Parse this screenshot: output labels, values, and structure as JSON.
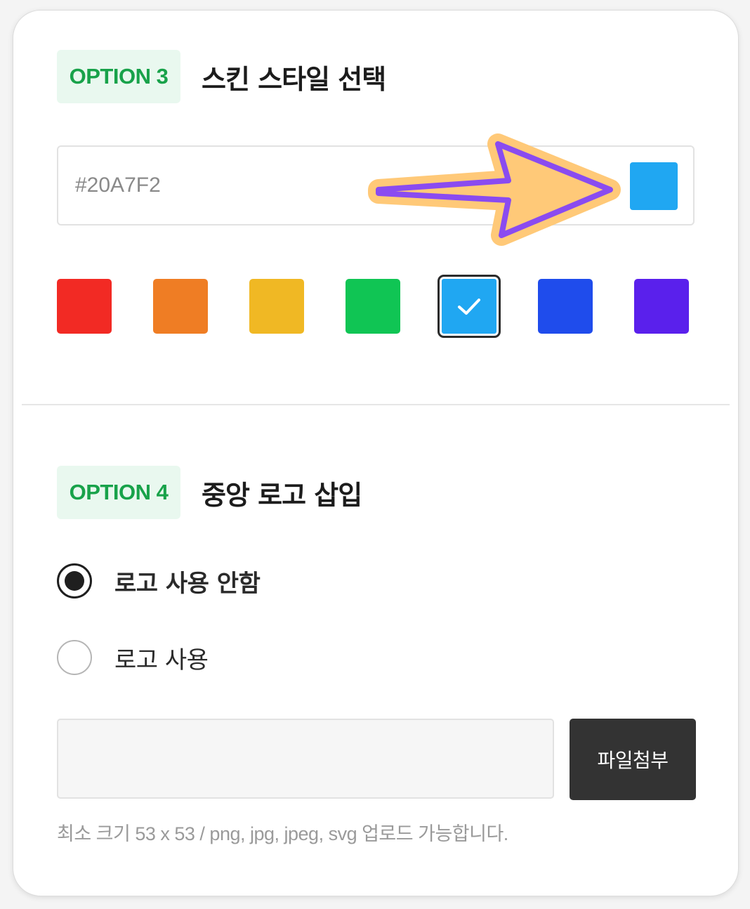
{
  "option3": {
    "badge": "OPTION 3",
    "title": "스킨 스타일 선택",
    "hex_value": "#20A7F2",
    "preview_color": "#20A7F2",
    "swatches": [
      {
        "color": "#F22A24",
        "selected": false
      },
      {
        "color": "#EF7D24",
        "selected": false
      },
      {
        "color": "#F0B824",
        "selected": false
      },
      {
        "color": "#10C554",
        "selected": false
      },
      {
        "color": "#20A7F2",
        "selected": true
      },
      {
        "color": "#1F4CEC",
        "selected": false
      },
      {
        "color": "#5A20EC",
        "selected": false
      }
    ],
    "check_icon": "check-icon",
    "annotation_arrow": "arrow-right-icon"
  },
  "option4": {
    "badge": "OPTION 4",
    "title": "중앙 로고 삽입",
    "radios": [
      {
        "label": "로고 사용 안함",
        "checked": true
      },
      {
        "label": "로고 사용",
        "checked": false
      }
    ],
    "file_value": "",
    "attach_label": "파일첨부",
    "hint": "최소 크기 53 x 53 / png, jpg, jpeg, svg 업로드 가능합니다."
  },
  "colors": {
    "badge_bg": "#E9F8EF",
    "badge_text": "#18A24A",
    "arrow_fill": "#FFC978",
    "arrow_stroke": "#8A4BF0",
    "button_bg": "#333333"
  }
}
